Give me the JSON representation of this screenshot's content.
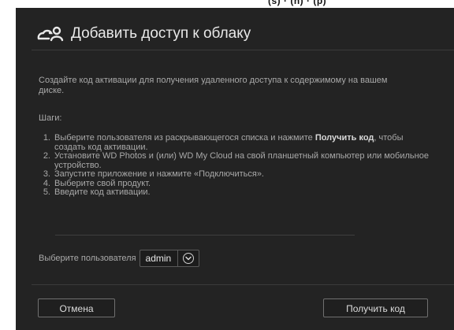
{
  "peek_text": "(s) · (n) · (p)",
  "dialog": {
    "title": "Добавить доступ к облаку",
    "intro": "Создайте код активации для получения удаленного доступа к содержимому на вашем диске.",
    "steps_label": "Шаги:",
    "steps": [
      {
        "num": "1.",
        "text_bold": "Получить код",
        "text_before": "Выберите пользователя из раскрывающегося списка и нажмите ",
        "text_after": ", чтобы создать код активации."
      },
      {
        "num": "2.",
        "text": "Установите WD Photos и (или) WD My Cloud на свой планшетный компьютер или мобильное устройство."
      },
      {
        "num": "3.",
        "text": "Запустите приложение и нажмите «Подключиться»."
      },
      {
        "num": "4.",
        "text": "Выберите свой продукт."
      },
      {
        "num": "5.",
        "text": "Введите код активации."
      }
    ],
    "user_label": "Выберите пользователя",
    "user_value": "admin",
    "cancel_label": "Отмена",
    "get_code_label": "Получить код"
  },
  "icons": {
    "title_icon": "cloud-user-icon",
    "select_icon": "chevron-down-circle-icon"
  },
  "colors": {
    "dialog_bg": "#232323",
    "text": "#a9a9a9",
    "title": "#e8e8e8"
  }
}
